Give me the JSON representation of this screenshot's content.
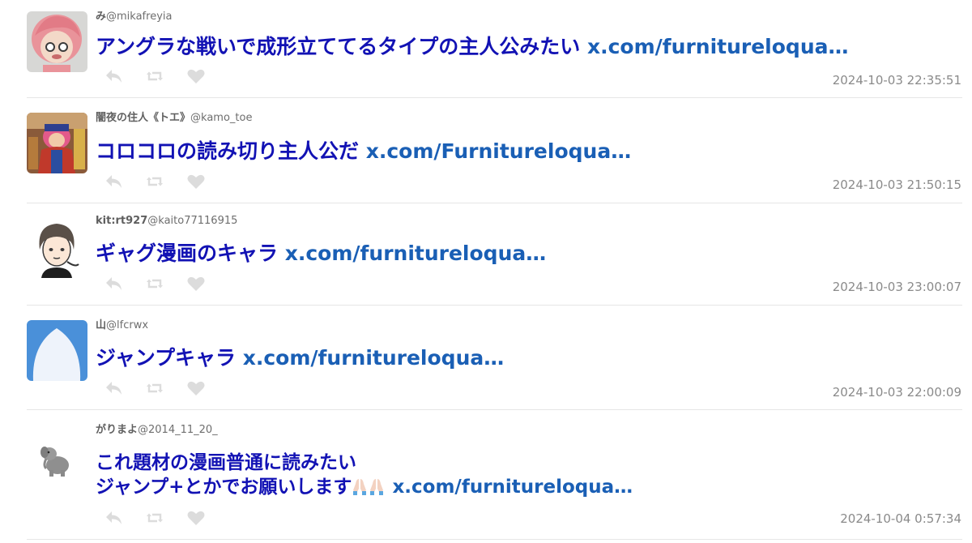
{
  "tweets": [
    {
      "display_name": "み",
      "handle": "@mikafreyia",
      "text": "アングラな戦いで成形立ててるタイプの主人公みたい",
      "link": "x.com/furnitureloqua…",
      "timestamp": "2024-10-03 22:35:51",
      "avatar": "pink-hair-figure-avatar"
    },
    {
      "display_name": "闇夜の住人《トエ》",
      "handle": "@kamo_toe",
      "text": "コロコロの読み切り主人公だ",
      "link": "x.com/Furnitureloqua…",
      "timestamp": "2024-10-03 21:50:15",
      "avatar": "red-costume-character-avatar"
    },
    {
      "display_name": "kit:rt927",
      "handle": "@kaito77116915",
      "text": "ギャグ漫画のキャラ",
      "link": "x.com/furnitureloqua…",
      "timestamp": "2024-10-03 23:00:07",
      "avatar": "sketch-person-avatar"
    },
    {
      "display_name": "山",
      "handle": "@lfcrwx",
      "text": "ジャンプキャラ",
      "link": "x.com/furnitureloqua…",
      "timestamp": "2024-10-03 22:00:09",
      "avatar": "default-egg-avatar"
    },
    {
      "display_name": "がりまよ",
      "handle": "@2014_11_20_",
      "text_line1": "これ題材の漫画普通に読みたい",
      "text_line2": "ジャンプ+とかでお願いします",
      "emoji": "🙏🏻🙏🏻",
      "link": "x.com/furnitureloqua…",
      "timestamp": "2024-10-04 0:57:34",
      "avatar": "elephant-plush-avatar"
    }
  ],
  "colors": {
    "body_text": "#1212b4",
    "link": "#1a5fb5",
    "meta": "#8a8a8a",
    "icon": "#dcdcdc",
    "divider": "#e6e6e6"
  },
  "icons": {
    "reply": "reply-icon",
    "retweet": "retweet-icon",
    "like": "heart-icon"
  }
}
